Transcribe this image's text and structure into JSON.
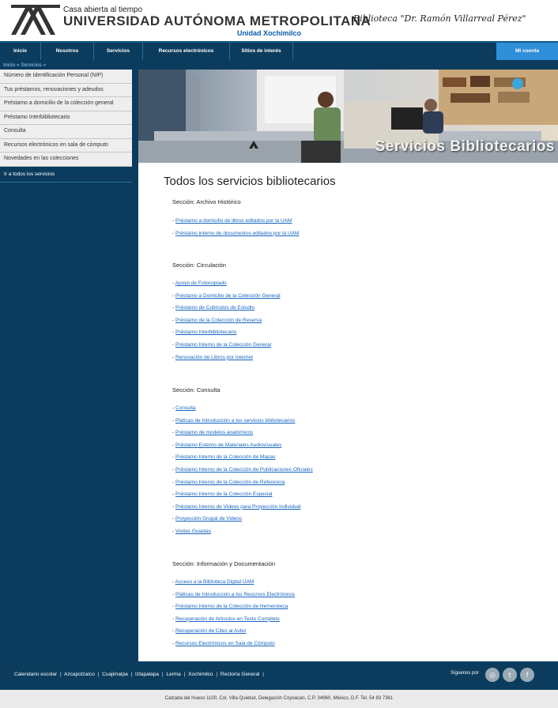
{
  "header": {
    "logo_small": "Casa abierta al tiempo",
    "logo_big": "UNIVERSIDAD AUTÓNOMA METROPOLITANA",
    "logo_unit": "Unidad Xochimilco",
    "library_name": "Biblioteca \"Dr. Ramón Villarreal Pérez\""
  },
  "nav": {
    "items": [
      "Inicio",
      "Nosotros",
      "Servicios",
      "Recursos electrónicos",
      "Sitios de interés"
    ],
    "account": "Mi cuenta"
  },
  "breadcrumb": "Inicio » Servicios »",
  "sidebar": {
    "items": [
      "Número de Identificación Personal (NIP)",
      "Tus préstamos, renovaciones y adeudos",
      "Préstamo a domicilio de la colección general",
      "Préstamo Interbibliotecario",
      "Consulta",
      "Recursos electrónicos en sala de cómputo",
      "Novedades en las colecciones"
    ],
    "all_services": "Ir a todos los servicios"
  },
  "banner": {
    "title": "Servicios Bibliotecarios"
  },
  "main": {
    "title": "Todos los servicios bibliotecarios",
    "sections": [
      {
        "title": "Sección: Archivo Histórico",
        "links": [
          "Préstamo a domicilio de libros editados por la UAM",
          "Préstamo interno de documentos editados por la UAM"
        ]
      },
      {
        "title": "Sección: Circulación",
        "links": [
          "Apoyo de Fotocopiado",
          "Préstamo a Domicilio de la Colección General",
          "Préstamo de Cubículos de Estudio",
          "Préstamo de la Colección de Reserva",
          "Préstamo Interbibliotecario",
          "Préstamo Interno de la Colección General",
          "Renovación de Libros por Internet"
        ]
      },
      {
        "title": "Sección: Consulta",
        "links": [
          "Consulta",
          "Pláticas de Introducción a los servicios bibliotecarios",
          "Préstamo de modelos anatómicos",
          "Préstamo Externo de Materiales Audiovisuales",
          "Préstamo Interno de la Colección de Mapas",
          "Préstamo Interno de la Colección de Publicaciones Oficiales",
          "Préstamo Interno de la Colección de Referencia",
          "Préstamo Interno de la Colección Especial",
          "Préstamo Interno de Videos para Proyección Individual",
          "Proyección Grupal de Videos",
          "Visitas Guiadas"
        ]
      },
      {
        "title": "Sección: Información y Documentación",
        "links": [
          "Acceso a la Biblioteca Digital UAM",
          "Pláticas de Introducción a los Recursos Electrónicos",
          "Préstamo Interno de la Colección de Hemeroteca",
          "Recuperación de Artículos en Texto Completo",
          "Recuperación de Cites al Autor",
          "Recursos Electrónicos en Sala de Cómputo"
        ]
      }
    ]
  },
  "footer": {
    "links": [
      "Calendario escolar",
      "Azcapotzalco",
      "Cuajimalpa",
      "Iztapalapa",
      "Lerma",
      "Xochimilco",
      "Rectoría General"
    ],
    "follow": "Síguenos por",
    "address": "Calzada del Hueso 1100, Col. Villa Quietud, Delegación Coyoacán, C.P. 04960, México, D.F. Tel. 54 83 7361"
  },
  "colors": {
    "dark_blue": "#0b3c5d",
    "accent_blue": "#2f8fd8",
    "link": "#1565c0"
  }
}
